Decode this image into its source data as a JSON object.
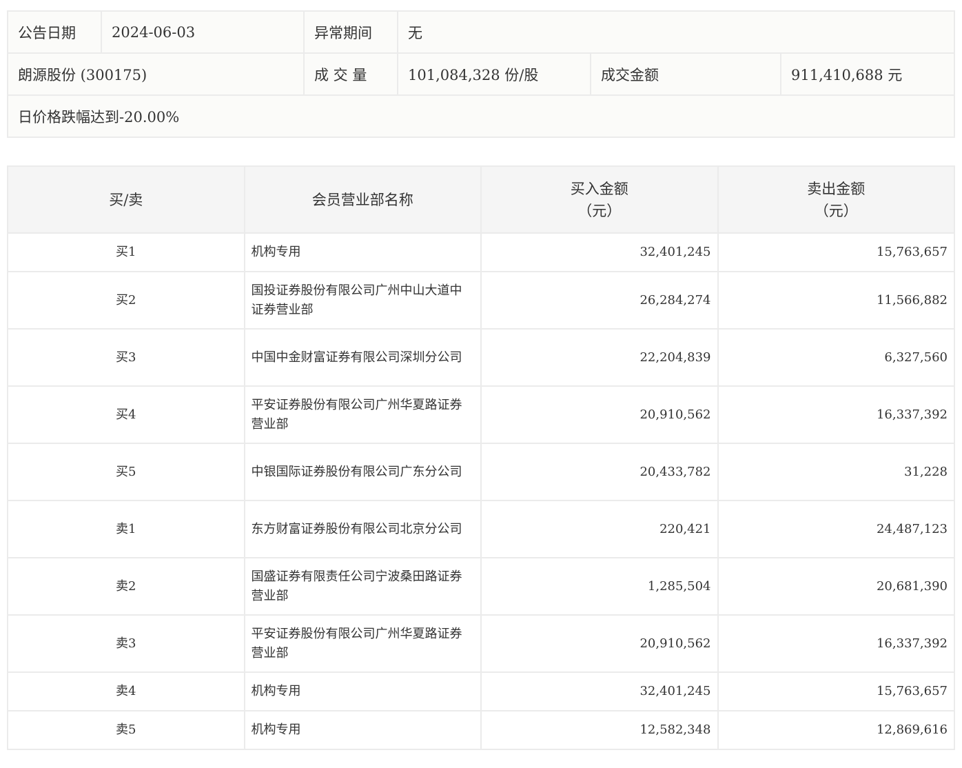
{
  "info": {
    "date_label": "公告日期",
    "date": "2024-06-03",
    "period_label": "异常期间",
    "period": "无",
    "stock": "朗源股份 (300175)",
    "volume_label": "成 交 量",
    "volume": "101,084,328 份/股",
    "amount_label": "成交金额",
    "amount": "911,410,688 元",
    "reason": "日价格跌幅达到-20.00%"
  },
  "headers": {
    "side": "买/卖",
    "name": "会员营业部名称",
    "buy": "买入金额",
    "buy_unit": "（元）",
    "sell": "卖出金额",
    "sell_unit": "（元）"
  },
  "rows": [
    {
      "side": "买1",
      "name": "机构专用",
      "buy": "32,401,245",
      "sell": "15,763,657"
    },
    {
      "side": "买2",
      "name": "国投证券股份有限公司广州中山大道中证券营业部",
      "buy": "26,284,274",
      "sell": "11,566,882"
    },
    {
      "side": "买3",
      "name": "中国中金财富证券有限公司深圳分公司",
      "buy": "22,204,839",
      "sell": "6,327,560"
    },
    {
      "side": "买4",
      "name": "平安证券股份有限公司广州华夏路证券营业部",
      "buy": "20,910,562",
      "sell": "16,337,392"
    },
    {
      "side": "买5",
      "name": "中银国际证券股份有限公司广东分公司",
      "buy": "20,433,782",
      "sell": "31,228"
    },
    {
      "side": "卖1",
      "name": "东方财富证券股份有限公司北京分公司",
      "buy": "220,421",
      "sell": "24,487,123"
    },
    {
      "side": "卖2",
      "name": "国盛证券有限责任公司宁波桑田路证券营业部",
      "buy": "1,285,504",
      "sell": "20,681,390"
    },
    {
      "side": "卖3",
      "name": "平安证券股份有限公司广州华夏路证券营业部",
      "buy": "20,910,562",
      "sell": "16,337,392"
    },
    {
      "side": "卖4",
      "name": "机构专用",
      "buy": "32,401,245",
      "sell": "15,763,657"
    },
    {
      "side": "卖5",
      "name": "机构专用",
      "buy": "12,582,348",
      "sell": "12,869,616"
    }
  ]
}
